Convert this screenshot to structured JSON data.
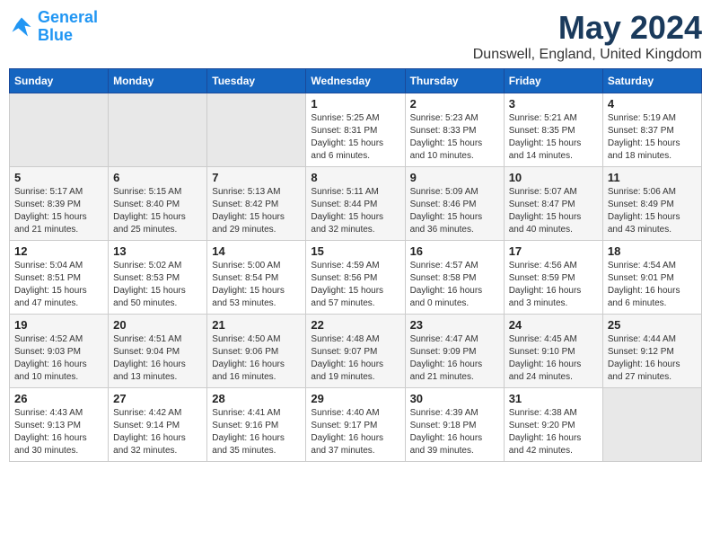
{
  "header": {
    "logo_line1": "General",
    "logo_line2": "Blue",
    "month": "May 2024",
    "location": "Dunswell, England, United Kingdom"
  },
  "days_of_week": [
    "Sunday",
    "Monday",
    "Tuesday",
    "Wednesday",
    "Thursday",
    "Friday",
    "Saturday"
  ],
  "weeks": [
    [
      {
        "day": "",
        "empty": true
      },
      {
        "day": "",
        "empty": true
      },
      {
        "day": "",
        "empty": true
      },
      {
        "day": "1",
        "sunrise": "5:25 AM",
        "sunset": "8:31 PM",
        "daylight": "15 hours and 6 minutes."
      },
      {
        "day": "2",
        "sunrise": "5:23 AM",
        "sunset": "8:33 PM",
        "daylight": "15 hours and 10 minutes."
      },
      {
        "day": "3",
        "sunrise": "5:21 AM",
        "sunset": "8:35 PM",
        "daylight": "15 hours and 14 minutes."
      },
      {
        "day": "4",
        "sunrise": "5:19 AM",
        "sunset": "8:37 PM",
        "daylight": "15 hours and 18 minutes."
      }
    ],
    [
      {
        "day": "5",
        "sunrise": "5:17 AM",
        "sunset": "8:39 PM",
        "daylight": "15 hours and 21 minutes."
      },
      {
        "day": "6",
        "sunrise": "5:15 AM",
        "sunset": "8:40 PM",
        "daylight": "15 hours and 25 minutes."
      },
      {
        "day": "7",
        "sunrise": "5:13 AM",
        "sunset": "8:42 PM",
        "daylight": "15 hours and 29 minutes."
      },
      {
        "day": "8",
        "sunrise": "5:11 AM",
        "sunset": "8:44 PM",
        "daylight": "15 hours and 32 minutes."
      },
      {
        "day": "9",
        "sunrise": "5:09 AM",
        "sunset": "8:46 PM",
        "daylight": "15 hours and 36 minutes."
      },
      {
        "day": "10",
        "sunrise": "5:07 AM",
        "sunset": "8:47 PM",
        "daylight": "15 hours and 40 minutes."
      },
      {
        "day": "11",
        "sunrise": "5:06 AM",
        "sunset": "8:49 PM",
        "daylight": "15 hours and 43 minutes."
      }
    ],
    [
      {
        "day": "12",
        "sunrise": "5:04 AM",
        "sunset": "8:51 PM",
        "daylight": "15 hours and 47 minutes."
      },
      {
        "day": "13",
        "sunrise": "5:02 AM",
        "sunset": "8:53 PM",
        "daylight": "15 hours and 50 minutes."
      },
      {
        "day": "14",
        "sunrise": "5:00 AM",
        "sunset": "8:54 PM",
        "daylight": "15 hours and 53 minutes."
      },
      {
        "day": "15",
        "sunrise": "4:59 AM",
        "sunset": "8:56 PM",
        "daylight": "15 hours and 57 minutes."
      },
      {
        "day": "16",
        "sunrise": "4:57 AM",
        "sunset": "8:58 PM",
        "daylight": "16 hours and 0 minutes."
      },
      {
        "day": "17",
        "sunrise": "4:56 AM",
        "sunset": "8:59 PM",
        "daylight": "16 hours and 3 minutes."
      },
      {
        "day": "18",
        "sunrise": "4:54 AM",
        "sunset": "9:01 PM",
        "daylight": "16 hours and 6 minutes."
      }
    ],
    [
      {
        "day": "19",
        "sunrise": "4:52 AM",
        "sunset": "9:03 PM",
        "daylight": "16 hours and 10 minutes."
      },
      {
        "day": "20",
        "sunrise": "4:51 AM",
        "sunset": "9:04 PM",
        "daylight": "16 hours and 13 minutes."
      },
      {
        "day": "21",
        "sunrise": "4:50 AM",
        "sunset": "9:06 PM",
        "daylight": "16 hours and 16 minutes."
      },
      {
        "day": "22",
        "sunrise": "4:48 AM",
        "sunset": "9:07 PM",
        "daylight": "16 hours and 19 minutes."
      },
      {
        "day": "23",
        "sunrise": "4:47 AM",
        "sunset": "9:09 PM",
        "daylight": "16 hours and 21 minutes."
      },
      {
        "day": "24",
        "sunrise": "4:45 AM",
        "sunset": "9:10 PM",
        "daylight": "16 hours and 24 minutes."
      },
      {
        "day": "25",
        "sunrise": "4:44 AM",
        "sunset": "9:12 PM",
        "daylight": "16 hours and 27 minutes."
      }
    ],
    [
      {
        "day": "26",
        "sunrise": "4:43 AM",
        "sunset": "9:13 PM",
        "daylight": "16 hours and 30 minutes."
      },
      {
        "day": "27",
        "sunrise": "4:42 AM",
        "sunset": "9:14 PM",
        "daylight": "16 hours and 32 minutes."
      },
      {
        "day": "28",
        "sunrise": "4:41 AM",
        "sunset": "9:16 PM",
        "daylight": "16 hours and 35 minutes."
      },
      {
        "day": "29",
        "sunrise": "4:40 AM",
        "sunset": "9:17 PM",
        "daylight": "16 hours and 37 minutes."
      },
      {
        "day": "30",
        "sunrise": "4:39 AM",
        "sunset": "9:18 PM",
        "daylight": "16 hours and 39 minutes."
      },
      {
        "day": "31",
        "sunrise": "4:38 AM",
        "sunset": "9:20 PM",
        "daylight": "16 hours and 42 minutes."
      },
      {
        "day": "",
        "empty": true
      }
    ]
  ],
  "labels": {
    "sunrise_label": "Sunrise:",
    "sunset_label": "Sunset:",
    "daylight_label": "Daylight:"
  }
}
